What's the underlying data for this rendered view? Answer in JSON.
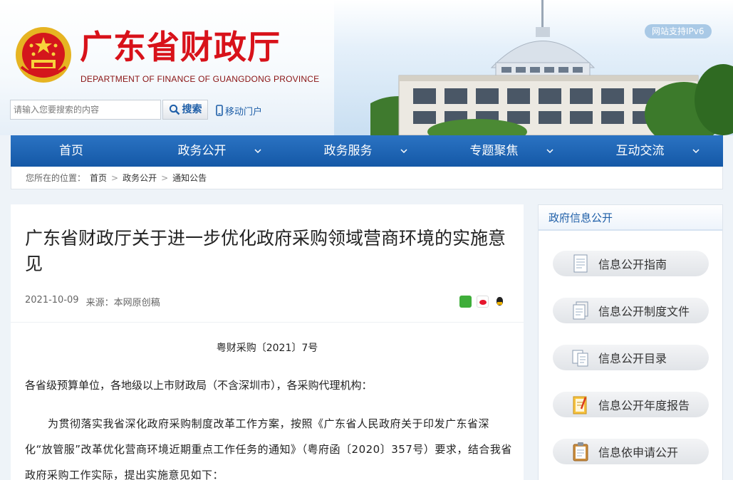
{
  "header": {
    "title": "广东省财政厅",
    "subtitle": "DEPARTMENT OF FINANCE OF GUANGDONG PROVINCE",
    "ipv6_badge": "网站支持IPv6",
    "search_placeholder": "请输入您要搜索的内容",
    "search_button": "搜索",
    "mobile_label": "移动门户"
  },
  "nav": {
    "items": [
      {
        "label": "首页",
        "has_dropdown": false
      },
      {
        "label": "政务公开",
        "has_dropdown": true
      },
      {
        "label": "政务服务",
        "has_dropdown": true
      },
      {
        "label": "专题聚焦",
        "has_dropdown": true
      },
      {
        "label": "互动交流",
        "has_dropdown": true
      }
    ]
  },
  "breadcrumb": {
    "prefix": "您所在的位置：",
    "items": [
      "首页",
      "政务公开",
      "通知公告"
    ],
    "separator": ">"
  },
  "article": {
    "title": "广东省财政厅关于进一步优化政府采购领域营商环境的实施意见",
    "date": "2021-10-09",
    "source": "来源：本网原创稿",
    "share_icons": [
      "wechat-icon",
      "weibo-icon",
      "qq-icon"
    ],
    "doc_number": "粤财采购〔2021〕7号",
    "paragraph1": "各省级预算单位，各地级以上市财政局（不含深圳市），各采购代理机构：",
    "paragraph2": "为贯彻落实我省深化政府采购制度改革工作方案，按照《广东省人民政府关于印发广东省深化“放管服”改革优化营商环境近期重点工作任务的通知》（粤府函〔2020〕357号）要求，结合我省政府采购工作实际，提出实施意见如下："
  },
  "sidebar": {
    "heading": "政府信息公开",
    "items": [
      {
        "label": "信息公开指南",
        "icon": "guide-doc-icon"
      },
      {
        "label": "信息公开制度文件",
        "icon": "rules-doc-icon"
      },
      {
        "label": "信息公开目录",
        "icon": "catalog-icon"
      },
      {
        "label": "信息公开年度报告",
        "icon": "annual-report-icon"
      },
      {
        "label": "信息依申请公开",
        "icon": "clipboard-icon"
      }
    ]
  },
  "colors": {
    "brand_red": "#d8121a",
    "nav_blue": "#1d62b1",
    "link_blue": "#1f5fa8"
  }
}
